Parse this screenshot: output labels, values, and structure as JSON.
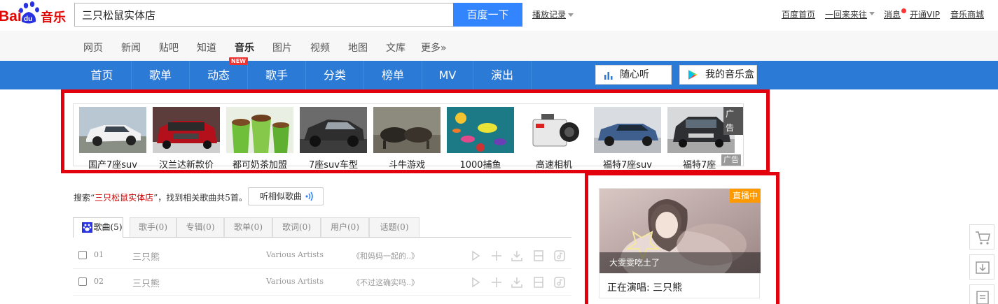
{
  "logo": {
    "text_bai": "Bai",
    "text_du": "du",
    "text_music": "音乐"
  },
  "search": {
    "value": "三只松鼠实体店",
    "button_label": "百度一下"
  },
  "history": {
    "label": "播放记录"
  },
  "toplinks": [
    {
      "label": "百度首页"
    },
    {
      "label": "一回来来往"
    },
    {
      "label": "消息"
    },
    {
      "label": "开通VIP"
    },
    {
      "label": "音乐商城"
    }
  ],
  "channels": [
    {
      "label": "网页"
    },
    {
      "label": "新闻"
    },
    {
      "label": "贴吧"
    },
    {
      "label": "知道"
    },
    {
      "label": "音乐"
    },
    {
      "label": "图片"
    },
    {
      "label": "视频"
    },
    {
      "label": "地图"
    },
    {
      "label": "文库"
    },
    {
      "label": "更多»"
    }
  ],
  "musicnav": {
    "tabs": [
      {
        "label": "首页"
      },
      {
        "label": "歌单"
      },
      {
        "label": "动态"
      },
      {
        "label": "歌手"
      },
      {
        "label": "分类"
      },
      {
        "label": "榜单"
      },
      {
        "label": "MV"
      },
      {
        "label": "演出"
      }
    ],
    "new_badge": "NEW",
    "random_listen": "随心听",
    "my_music_box": "我的音乐盒"
  },
  "ads": {
    "items": [
      {
        "caption": "国产7座suv"
      },
      {
        "caption": "汉兰达新款价"
      },
      {
        "caption": "都可奶茶加盟"
      },
      {
        "caption": "7座suv车型"
      },
      {
        "caption": "斗牛游戏"
      },
      {
        "caption": "1000捕鱼"
      },
      {
        "caption": "高速相机"
      },
      {
        "caption": "福特7座suv"
      },
      {
        "caption": "福特7座"
      }
    ],
    "ad_label": "广告"
  },
  "result": {
    "prefix": "搜索“",
    "keyword": "三只松鼠实体店",
    "suffix": "”，找到相关歌曲共5首。",
    "similar_button": "听相似歌曲"
  },
  "tabs": [
    {
      "label": "歌曲(5)"
    },
    {
      "label": "歌手(0)"
    },
    {
      "label": "专辑(0)"
    },
    {
      "label": "歌单(0)"
    },
    {
      "label": "歌词(0)"
    },
    {
      "label": "用户(0)"
    },
    {
      "label": "话题(0)"
    }
  ],
  "songs": [
    {
      "num": "01",
      "title": "三只熊",
      "artist": "Various Artists",
      "album": "《和妈妈一起的..》"
    },
    {
      "num": "02",
      "title": "三只熊",
      "artist": "Various Artists",
      "album": "《不过这确实吗..》"
    }
  ],
  "live": {
    "tag": "直播中",
    "name": "大雯雯吃土了",
    "now_playing": "正在演唱: 三只熊"
  },
  "colors": {
    "accent_blue": "#3385ff",
    "nav_blue": "#2b7ad6",
    "highlight_red": "#e3010e",
    "live_orange": "#ff9900"
  }
}
